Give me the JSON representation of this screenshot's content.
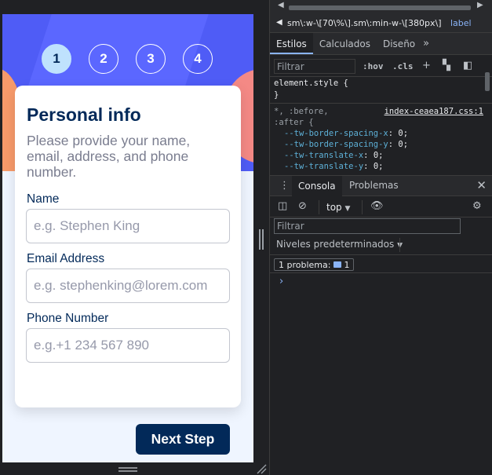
{
  "app": {
    "steps": [
      "1",
      "2",
      "3",
      "4"
    ],
    "active_step": 1,
    "card": {
      "title": "Personal info",
      "description": "Please provide your name, email, address, and phone number.",
      "fields": [
        {
          "label": "Name",
          "placeholder": "e.g. Stephen King"
        },
        {
          "label": "Email Address",
          "placeholder": "e.g. stephenking@lorem.com"
        },
        {
          "label": "Phone Number",
          "placeholder": "e.g.+1 234 567 890"
        }
      ]
    },
    "next_button": "Next Step",
    "colors": {
      "primary": "#022959",
      "hero": "#4f5cf6",
      "active_step": "#bfe2fd",
      "background": "#eff5ff"
    }
  },
  "devtools": {
    "breadcrumb": "sm\\:w-\\[70\\%\\].sm\\:min-w-\\[380px\\]",
    "breadcrumb_tag": "label",
    "tabs": [
      "Estilos",
      "Calculados",
      "Diseño"
    ],
    "tab_more": "»",
    "filter_placeholder": "Filtrar",
    "hov": ":hov",
    "cls": ".cls",
    "styles": {
      "element_style": "element.style {",
      "close_brace": "}",
      "universal_selector": "*, :before,",
      "after_selector": ":after {",
      "source": "index-ceaea187.css:1",
      "declarations": [
        {
          "prop": "--tw-border-spacing-x",
          "value": "0;"
        },
        {
          "prop": "--tw-border-spacing-y",
          "value": "0;"
        },
        {
          "prop": "--tw-translate-x",
          "value": "0;"
        },
        {
          "prop": "--tw-translate-y",
          "value": "0;"
        }
      ]
    },
    "drawer_tabs": [
      "Consola",
      "Problemas"
    ],
    "context": "top",
    "console_filter_placeholder": "Filtrar",
    "levels": "Niveles predeterminados",
    "issues_label": "1 problema:",
    "issues_count": "1",
    "prompt": "›"
  }
}
